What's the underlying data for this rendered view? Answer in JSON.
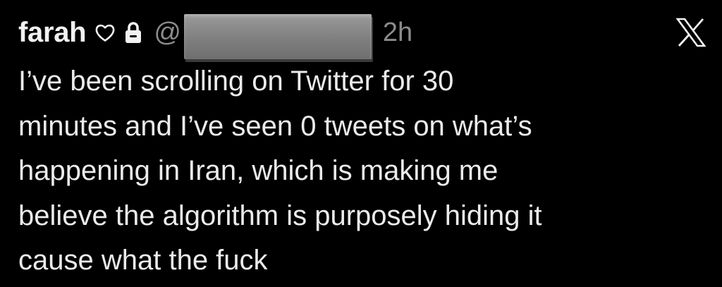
{
  "post": {
    "display_name": "farah",
    "handle_prefix": "@",
    "timestamp": "2h",
    "lines": [
      "I’ve been scrolling on Twitter for 30",
      "minutes and I’ve seen 0 tweets on what’s",
      "happening in Iran, which is making me",
      "believe the algorithm is purposely hiding it",
      "cause what the fuck"
    ]
  },
  "icons": {
    "heart": "heart-outline-icon",
    "lock": "lock-icon",
    "brand": "x-logo-icon"
  },
  "colors": {
    "background": "#000000",
    "text": "#ebebeb",
    "muted": "#8b8b8b",
    "redaction": "#8a8a8a"
  }
}
